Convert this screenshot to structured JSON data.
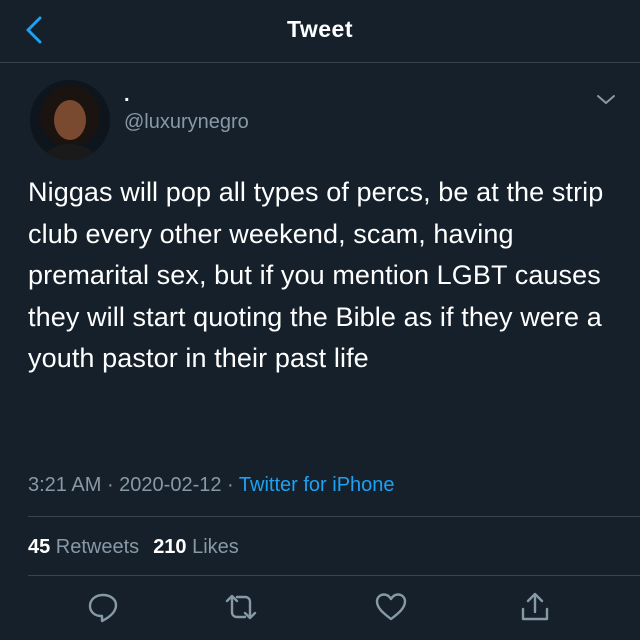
{
  "header": {
    "title": "Tweet",
    "back_icon": "chevron-left-icon"
  },
  "author": {
    "display_name": ".",
    "handle": "@luxurynegro",
    "menu_icon": "chevron-down-icon"
  },
  "tweet": {
    "text": "Niggas will pop all types of percs, be at the strip club every other weekend, scam, having premarital sex, but if you mention LGBT causes they will start quoting the Bible as if they were a youth pastor in their past life",
    "time": "3:21 AM",
    "sep1": " · ",
    "date": "2020-02-12",
    "sep2": " · ",
    "source": "Twitter for iPhone"
  },
  "stats": {
    "retweets_count": "45",
    "retweets_label": " Retweets",
    "likes_count": "210",
    "likes_label": " Likes"
  },
  "actions": [
    "reply-icon",
    "retweet-icon",
    "like-icon",
    "share-icon"
  ],
  "colors": {
    "background": "#15202b",
    "accent": "#1da1f2",
    "secondary_text": "#8899a6",
    "divider": "#38444d"
  }
}
